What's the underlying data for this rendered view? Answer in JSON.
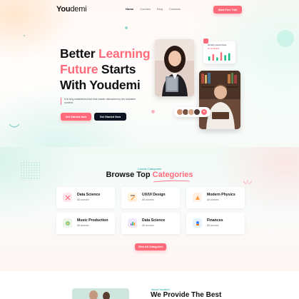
{
  "brand": {
    "logo_bold": "You",
    "logo_rest": "demi"
  },
  "nav": {
    "items": [
      "Home",
      "Courses",
      "Blog",
      "Contacts"
    ]
  },
  "header": {
    "cta": "Start Free Trial"
  },
  "hero": {
    "title_line1_a": "Better ",
    "title_line1_b": "Learning",
    "title_line2_a": "Future",
    "title_line2_b": " Starts",
    "title_line3": "With Youdemi",
    "description": "It is long established fact that reader distracted by the readable content.",
    "btn_primary": "Get Started Now",
    "btn_secondary": "Get Started Now",
    "stats_title": "Monthly Growth Rate",
    "stats_sub": "At of 23 Bits",
    "stats_bars": [
      0.45,
      0.7,
      0.35,
      0.9,
      0.6,
      0.8
    ],
    "avatar_more": "+"
  },
  "categories": {
    "kicker": "Course Categories",
    "title_a": "Browse Top ",
    "title_b": "Categories",
    "items": [
      {
        "name": "Data Science",
        "count": "68 courses",
        "icon": "chart-icon",
        "color": "#fde7ea"
      },
      {
        "name": "UX/UI Design",
        "count": "68 courses",
        "icon": "pen-icon",
        "color": "#fff3e0"
      },
      {
        "name": "Modern Physics",
        "count": "68 courses",
        "icon": "atom-icon",
        "color": "#fff1e6"
      },
      {
        "name": "Music Production",
        "count": "68 courses",
        "icon": "music-icon",
        "color": "#eef6ea"
      },
      {
        "name": "Data Science",
        "count": "68 courses",
        "icon": "data-icon",
        "color": "#efe9fb"
      },
      {
        "name": "Finances",
        "count": "68 courses",
        "icon": "finance-icon",
        "color": "#e6f3fb"
      }
    ],
    "view_all": "View All Categories"
  },
  "about": {
    "kicker": "About Youdemi",
    "title": "We Provide The Best"
  },
  "colors": {
    "accent": "#ff6b7a",
    "dark": "#0d1321",
    "teal": "#0fa9a0"
  }
}
